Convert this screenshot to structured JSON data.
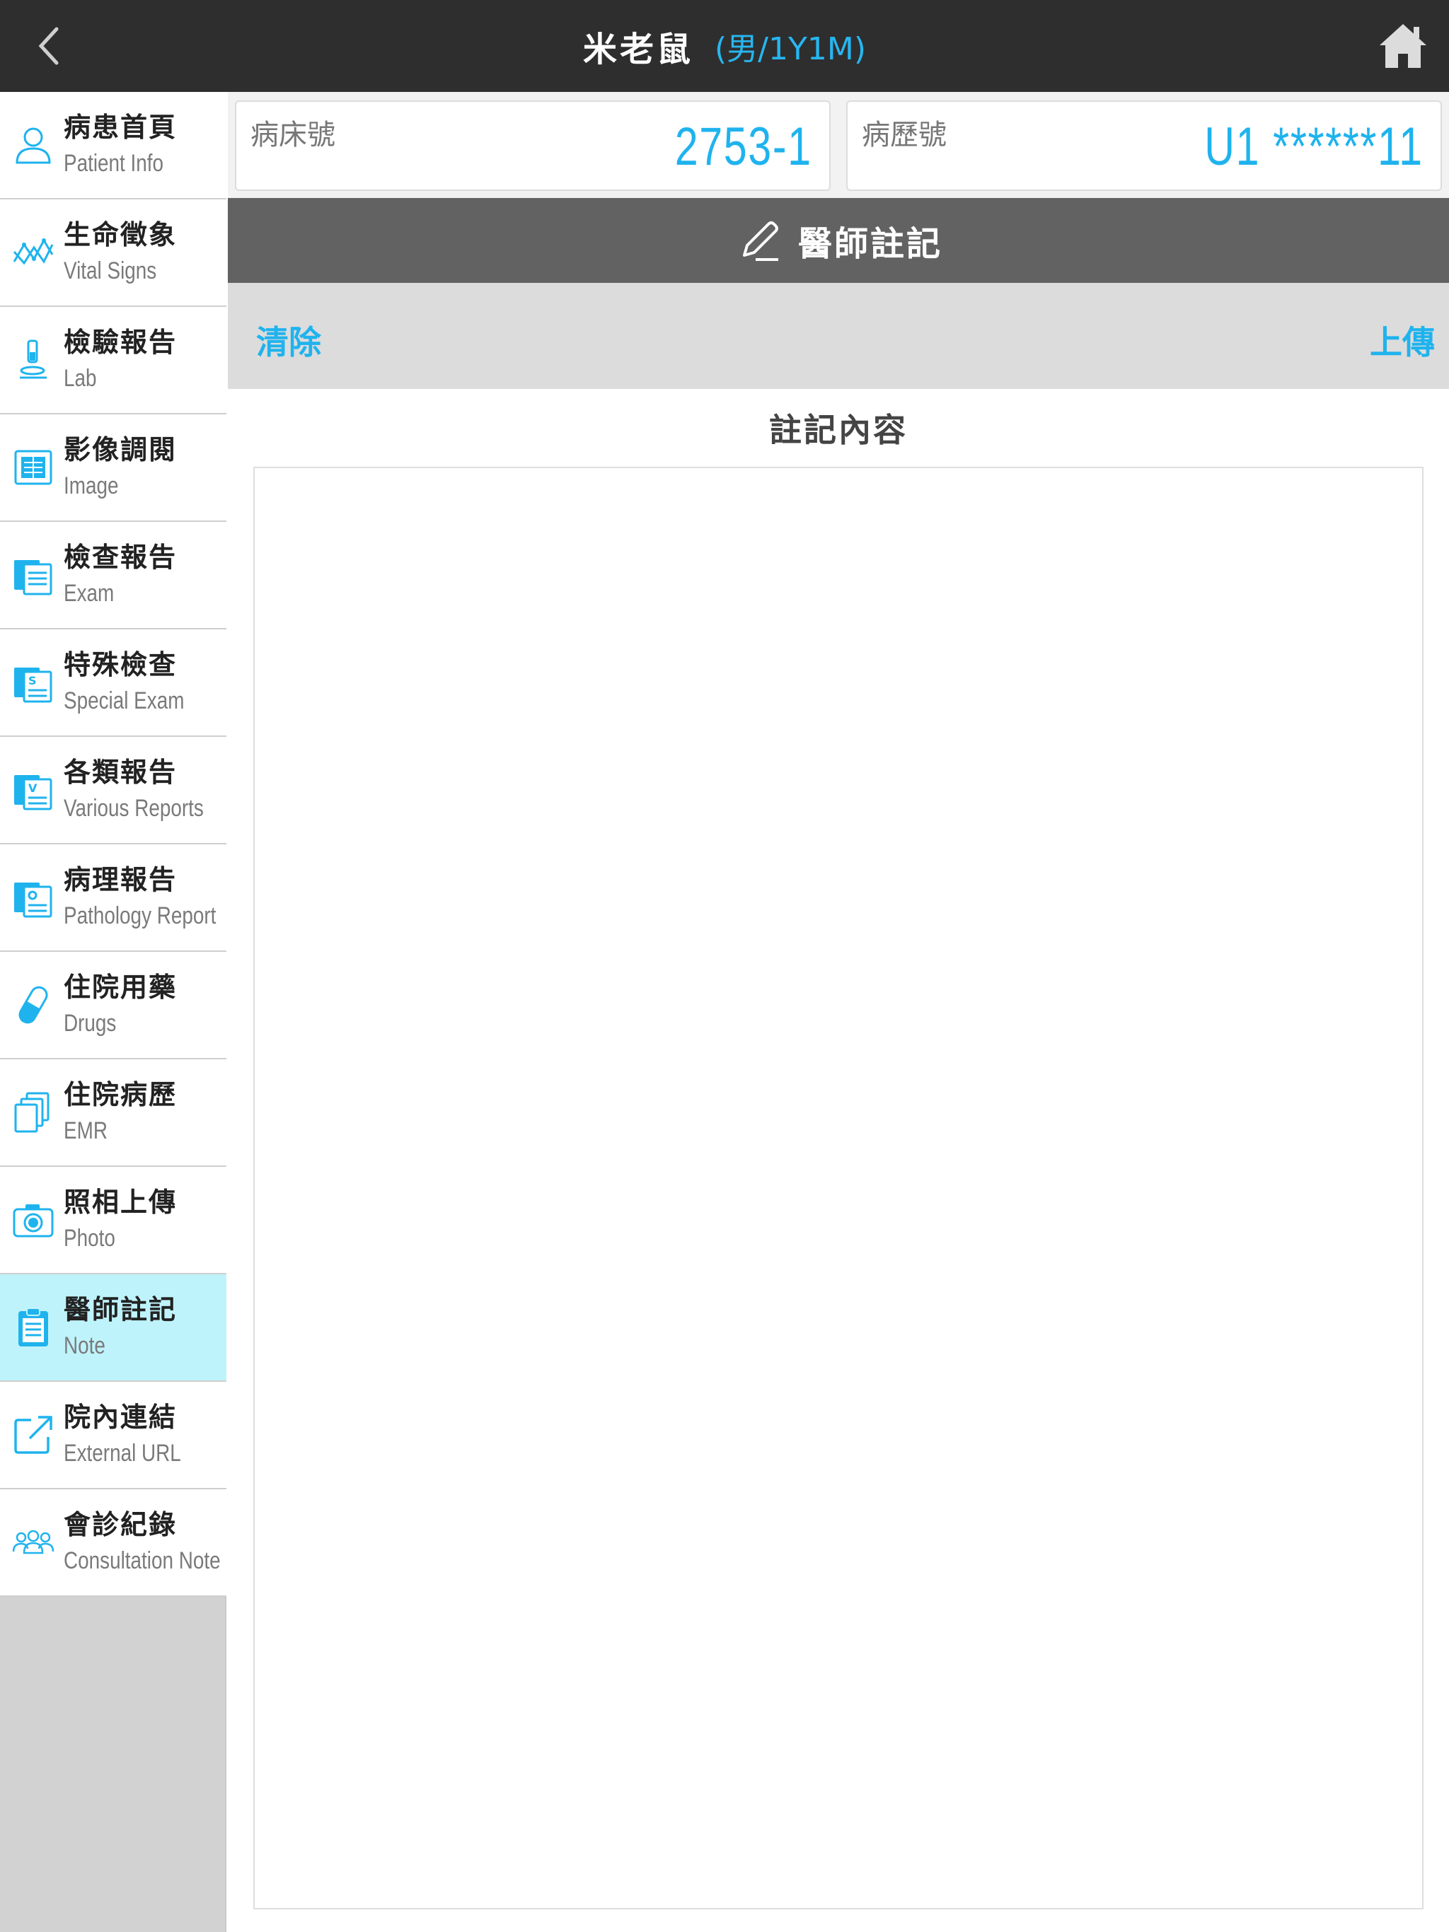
{
  "header": {
    "back_icon": "chevron-left-icon",
    "patient_name": "米老鼠",
    "patient_meta": "(男/1Y1M)",
    "home_icon": "home-icon"
  },
  "sidebar": {
    "items": [
      {
        "zh": "病患首頁",
        "en": "Patient Info",
        "icon": "person-icon"
      },
      {
        "zh": "生命徵象",
        "en": "Vital Signs",
        "icon": "chart-icon"
      },
      {
        "zh": "檢驗報告",
        "en": "Lab",
        "icon": "microscope-icon"
      },
      {
        "zh": "影像調閱",
        "en": "Image",
        "icon": "xray-icon"
      },
      {
        "zh": "檢查報告",
        "en": "Exam",
        "icon": "report-icon"
      },
      {
        "zh": "特殊檢查",
        "en": "Special Exam",
        "icon": "special-report-icon"
      },
      {
        "zh": "各類報告",
        "en": "Various Reports",
        "icon": "various-report-icon"
      },
      {
        "zh": "病理報告",
        "en": "Pathology Report",
        "icon": "pathology-report-icon"
      },
      {
        "zh": "住院用藥",
        "en": "Drugs",
        "icon": "capsule-icon"
      },
      {
        "zh": "住院病歷",
        "en": "EMR",
        "icon": "documents-icon"
      },
      {
        "zh": "照相上傳",
        "en": "Photo",
        "icon": "camera-icon"
      },
      {
        "zh": "醫師註記",
        "en": "Note",
        "icon": "clipboard-icon"
      },
      {
        "zh": "院內連結",
        "en": "External URL",
        "icon": "external-link-icon"
      },
      {
        "zh": "會診紀錄",
        "en": "Consultation Note",
        "icon": "group-icon"
      }
    ],
    "active_index": 11
  },
  "info": {
    "bed_label": "病床號",
    "bed_value": "2753-1",
    "mrn_label": "病歷號",
    "mrn_value": "U1 ******11"
  },
  "section": {
    "icon": "pencil-icon",
    "title": "醫師註記"
  },
  "actions": {
    "clear_label": "清除",
    "upload_label": "上傳"
  },
  "content": {
    "title": "註記內容",
    "note_value": ""
  },
  "colors": {
    "accent": "#1fb3ee",
    "header_bg": "#2e2e2e",
    "section_bg": "#626262",
    "active_item_bg": "#bff3fb"
  }
}
